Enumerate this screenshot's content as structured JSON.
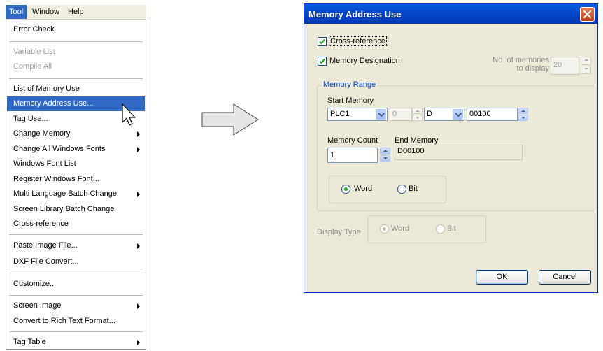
{
  "menubar": {
    "items": [
      "Tool",
      "Window",
      "Help"
    ]
  },
  "menu": {
    "items": [
      {
        "label": "Error Check"
      },
      {
        "label": "Variable List"
      },
      {
        "label": "Compile All"
      },
      {
        "label": "List of Memory Use"
      },
      {
        "label": "Memory Address Use..."
      },
      {
        "label": "Tag Use..."
      },
      {
        "label": "Change Memory"
      },
      {
        "label": "Change All Windows Fonts"
      },
      {
        "label": "Windows Font List"
      },
      {
        "label": "Register Windows Font..."
      },
      {
        "label": "Multi Language Batch Change"
      },
      {
        "label": "Screen Library Batch Change"
      },
      {
        "label": "Cross-reference"
      },
      {
        "label": "Paste Image File..."
      },
      {
        "label": "DXF File Convert..."
      },
      {
        "label": "Customize..."
      },
      {
        "label": "Screen Image"
      },
      {
        "label": "Convert to Rich Text Format..."
      },
      {
        "label": "Tag Table"
      }
    ]
  },
  "dialog": {
    "title": "Memory Address Use",
    "cross_reference": {
      "label": "Cross-reference",
      "checked": true
    },
    "memory_designation": {
      "label": "Memory Designation",
      "checked": true
    },
    "no_of_memories": {
      "label_line1": "No. of memories",
      "label_line2": "to display",
      "value": "20"
    },
    "memory_range": {
      "title": "Memory Range",
      "start_memory_label": "Start Memory",
      "plc_value": "PLC1",
      "station_value": "0",
      "device_value": "D",
      "address_value": "00100",
      "memory_count_label": "Memory Count",
      "memory_count_value": "1",
      "end_memory_label": "End Memory",
      "end_memory_value": "D00100",
      "word_label": "Word",
      "bit_label": "Bit",
      "selected": "Word"
    },
    "display_type": {
      "label": "Display Type",
      "word_label": "Word",
      "bit_label": "Bit",
      "selected": "Word"
    },
    "ok_label": "OK",
    "cancel_label": "Cancel"
  },
  "colors": {
    "selection": "#316ac5",
    "titlebar": "#0446c9",
    "dialog_face": "#ece9d8",
    "group_title": "#0046d5"
  }
}
